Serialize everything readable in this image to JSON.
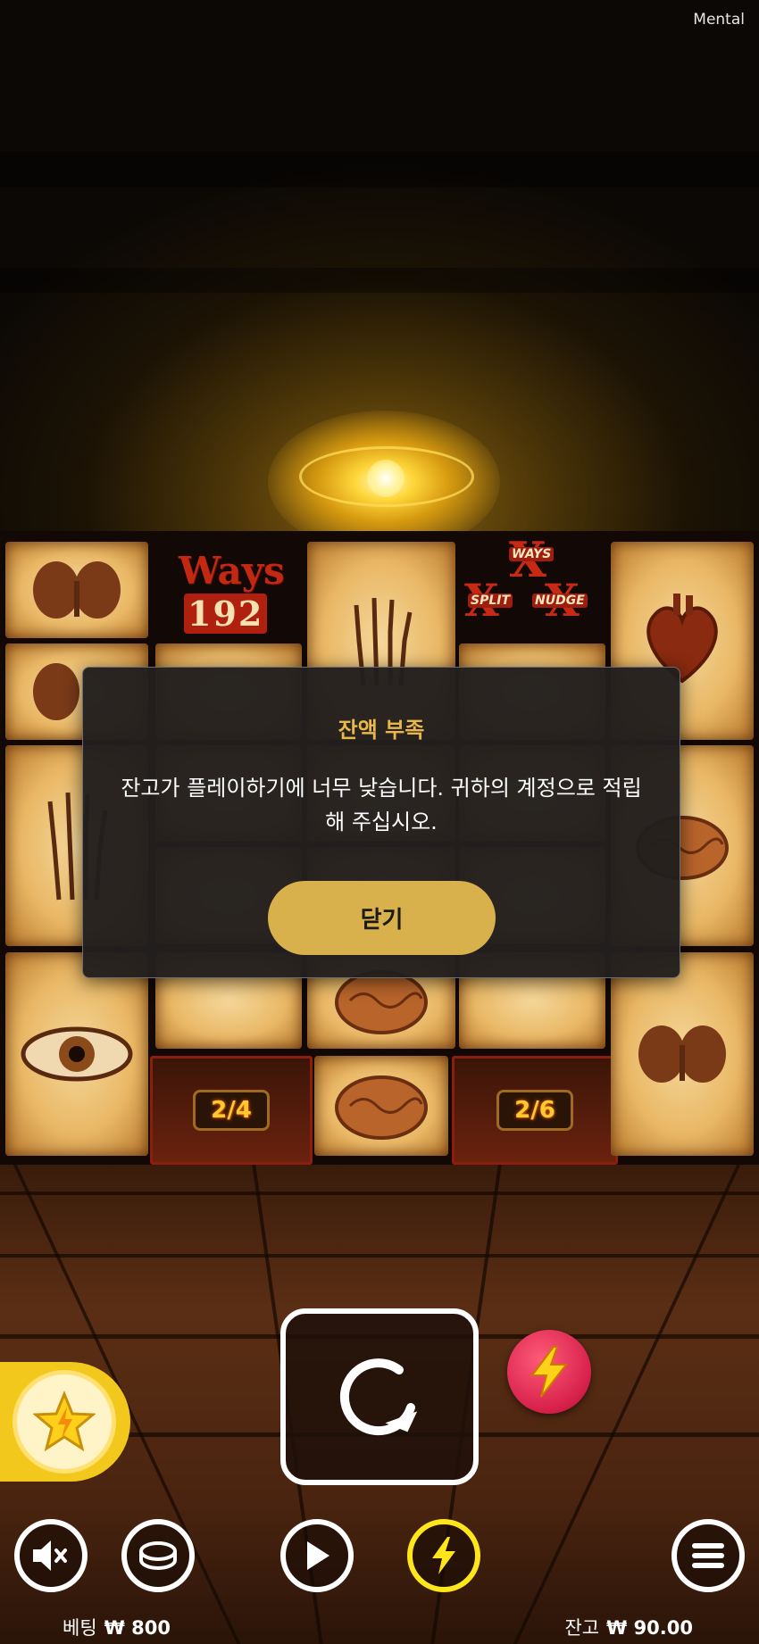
{
  "brand": "Mental",
  "reels": {
    "ways_label": "Ways",
    "ways_count": "192",
    "badge_ways": "WAYS",
    "badge_split": "SPLIT",
    "badge_nudge": "NUDGE",
    "counter_left": "2/4",
    "counter_right": "2/6"
  },
  "modal": {
    "title": "잔액 부족",
    "message": "잔고가 플레이하기에 너무 낮습니다. 귀하의 계정으로 적립해 주십시오.",
    "close_label": "닫기"
  },
  "footer": {
    "bet_label": "베팅",
    "bet_value": "₩ 800",
    "balance_label": "잔고",
    "balance_value": "₩ 90.00"
  },
  "colors": {
    "modal_title": "#e8b84a",
    "modal_button": "#d8b14c",
    "turbo": "#d6204a",
    "bonus": "#f2c81c",
    "autoplay_ring": "#ffe61a"
  },
  "icons": {
    "spin": "refresh-icon",
    "turbo": "lightning-icon",
    "bonus": "star-icon",
    "sound": "mute-icon",
    "coins": "coin-icon",
    "play": "play-icon",
    "autoplay": "lightning-icon",
    "menu": "menu-icon"
  }
}
